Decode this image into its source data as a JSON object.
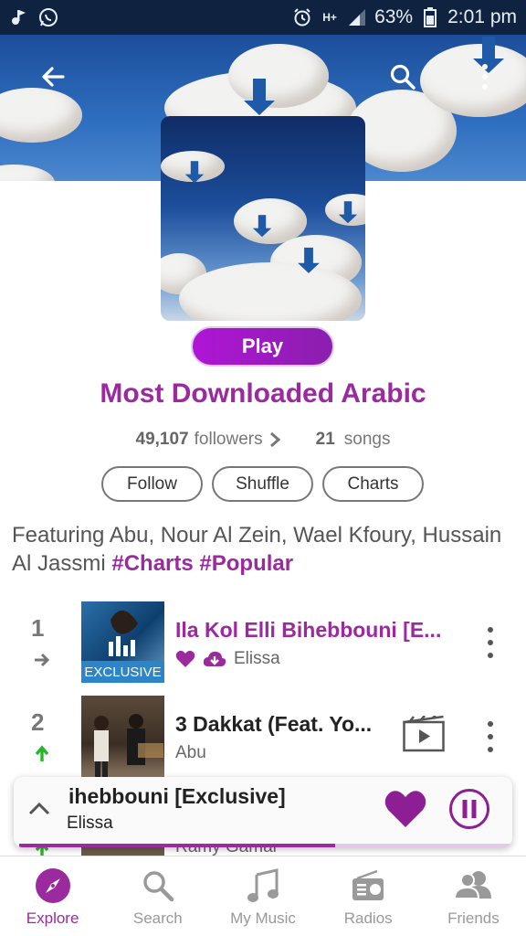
{
  "status_bar": {
    "battery": "63%",
    "time": "2:01 pm",
    "icons": [
      "music-notification-icon",
      "whatsapp-icon",
      "alarm-icon",
      "h-plus-icon",
      "signal-icon",
      "battery-icon"
    ]
  },
  "header": {
    "icons": [
      "back-arrow-icon",
      "search-icon",
      "more-vertical-icon"
    ]
  },
  "playlist": {
    "play_label": "Play",
    "title": "Most Downloaded Arabic",
    "followers_count": "49,107",
    "followers_label": "followers",
    "songs_count": "21",
    "songs_label": "songs",
    "buttons": {
      "follow": "Follow",
      "shuffle": "Shuffle",
      "charts": "Charts"
    },
    "description_text": "Featuring Abu, Nour Al Zein, Wael Kfoury, Hussain Al Jassmi",
    "hashtags": [
      "#Charts",
      "#Popular"
    ]
  },
  "tracks": [
    {
      "rank": "1",
      "trend": "same",
      "title": "Ila Kol Elli Bihebbouni [E...",
      "artist": "Elissa",
      "badge": "EXCLUSIVE",
      "liked": true,
      "downloaded": true,
      "title_color": "#9b2a9f"
    },
    {
      "rank": "2",
      "trend": "up",
      "title": "3 Dakkat (Feat. Yo...",
      "artist": "Abu",
      "has_video": true,
      "title_color": "#222222"
    },
    {
      "artist": "Ramy Gamal"
    }
  ],
  "mini_player": {
    "title": "ihebbouni [Exclusive]",
    "artist": "Elissa",
    "progress": 0.64,
    "liked": true,
    "state": "playing"
  },
  "nav": [
    {
      "label": "Explore",
      "icon": "compass-icon",
      "active": true
    },
    {
      "label": "Search",
      "icon": "search-icon",
      "active": false
    },
    {
      "label": "My Music",
      "icon": "music-note-icon",
      "active": false
    },
    {
      "label": "Radios",
      "icon": "radio-icon",
      "active": false
    },
    {
      "label": "Friends",
      "icon": "friends-icon",
      "active": false
    }
  ],
  "colors": {
    "accent": "#9b2a9f",
    "trend_up": "#2bb52b"
  }
}
